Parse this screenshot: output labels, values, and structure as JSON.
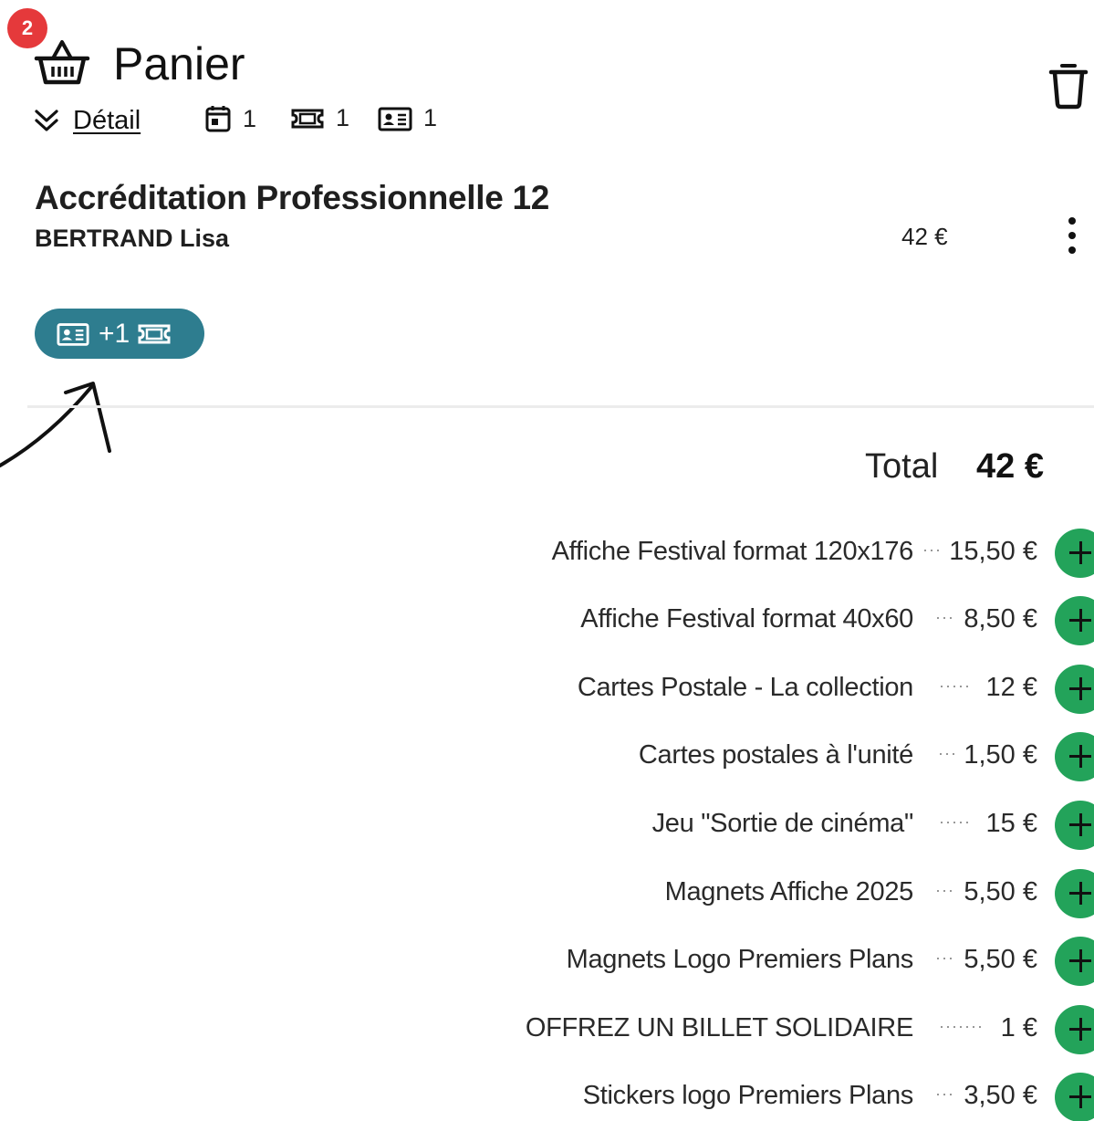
{
  "header": {
    "badge_count": "2",
    "title": "Panier",
    "detail_label": "Détail",
    "counters": [
      {
        "icon": "calendar-icon",
        "value": "1"
      },
      {
        "icon": "ticket-icon",
        "value": "1"
      },
      {
        "icon": "id-card-icon",
        "value": "1"
      }
    ]
  },
  "cart_item": {
    "name": "Accréditation Professionnelle 12",
    "holder": "BERTRAND Lisa",
    "price": "42 €",
    "pill_label": "+1",
    "pill_icons": [
      "id-card-icon",
      "ticket-icon"
    ]
  },
  "total": {
    "label": "Total",
    "value": "42 €"
  },
  "products": [
    {
      "name": "Affiche Festival format 120x176",
      "dots": "···",
      "price": "15,50 €"
    },
    {
      "name": "Affiche Festival format 40x60",
      "dots": "···",
      "price": "8,50 €"
    },
    {
      "name": "Cartes Postale - La collection",
      "dots": "·····",
      "price": "12 €"
    },
    {
      "name": "Cartes postales à l'unité",
      "dots": "···",
      "price": "1,50 €"
    },
    {
      "name": "Jeu \"Sortie de cinéma\"",
      "dots": "·····",
      "price": "15 €"
    },
    {
      "name": "Magnets Affiche 2025",
      "dots": "···",
      "price": "5,50 €"
    },
    {
      "name": "Magnets Logo Premiers Plans",
      "dots": "···",
      "price": "5,50 €"
    },
    {
      "name": "OFFREZ UN BILLET SOLIDAIRE",
      "dots": "·······",
      "price": "1 €"
    },
    {
      "name": "Stickers logo Premiers Plans",
      "dots": "···",
      "price": "3,50 €"
    }
  ],
  "colors": {
    "badge": "#e5393b",
    "pill": "#2e7d8f",
    "add_button": "#23a35a"
  }
}
